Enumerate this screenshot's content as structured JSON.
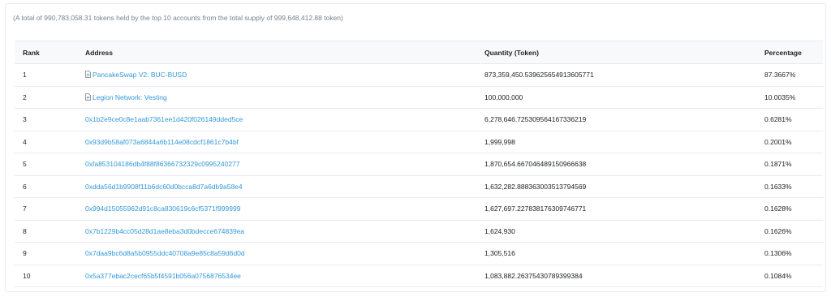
{
  "summary": "(A total of 990,783,058.31 tokens held by the top 10 accounts from the total supply of 999,648,412.88 token)",
  "columns": {
    "rank": "Rank",
    "address": "Address",
    "quantity": "Quantity (Token)",
    "percentage": "Percentage"
  },
  "rows": [
    {
      "rank": "1",
      "address": "PancakeSwap V2: BUC-BUSD",
      "labeled": true,
      "quantity": "873,359,450.539625654913605771",
      "percentage": "87.3667%"
    },
    {
      "rank": "2",
      "address": "Legion Network: Vesting",
      "labeled": true,
      "quantity": "100,000,000",
      "percentage": "10.0035%"
    },
    {
      "rank": "3",
      "address": "0x1b2e9ce0c8e1aab7361ee1d420f026149dded5ce",
      "labeled": false,
      "quantity": "6,278,646.725309564167336219",
      "percentage": "0.6281%"
    },
    {
      "rank": "4",
      "address": "0x93d9b58af073a6844a6b114e08cdcf1861c7b4bf",
      "labeled": false,
      "quantity": "1,999,998",
      "percentage": "0.2001%"
    },
    {
      "rank": "5",
      "address": "0xfa853104186db4f88f86366732329c0995240277",
      "labeled": false,
      "quantity": "1,870,654.667046489150966638",
      "percentage": "0.1871%"
    },
    {
      "rank": "6",
      "address": "0xdda56d1b9908f11b6dc60d0bcca8d7a6db9a58e4",
      "labeled": false,
      "quantity": "1,632,282.888363003513794569",
      "percentage": "0.1633%"
    },
    {
      "rank": "7",
      "address": "0x994d15055962d91c8ca830619c6cf5371f999999",
      "labeled": false,
      "quantity": "1,627,697.227838176309746771",
      "percentage": "0.1628%"
    },
    {
      "rank": "8",
      "address": "0x7b1229b4cc05d28d1ae8eba3d0bdecce674839ea",
      "labeled": false,
      "quantity": "1,624,930",
      "percentage": "0.1626%"
    },
    {
      "rank": "9",
      "address": "0x7daa9bc6d8a5b0955ddc40708a9e85c8a59d6d0d",
      "labeled": false,
      "quantity": "1,305,516",
      "percentage": "0.1306%"
    },
    {
      "rank": "10",
      "address": "0x5a377ebac2cecf65b5f4591b056a0756876534ee",
      "labeled": false,
      "quantity": "1,083,882.26375430789399384",
      "percentage": "0.1084%"
    }
  ],
  "colors": {
    "link": "#3498db",
    "muted": "#77838f",
    "header_bg": "#f8f9fa",
    "border": "#e7eaf3"
  },
  "icons": {
    "labeled_address": "document-icon"
  }
}
